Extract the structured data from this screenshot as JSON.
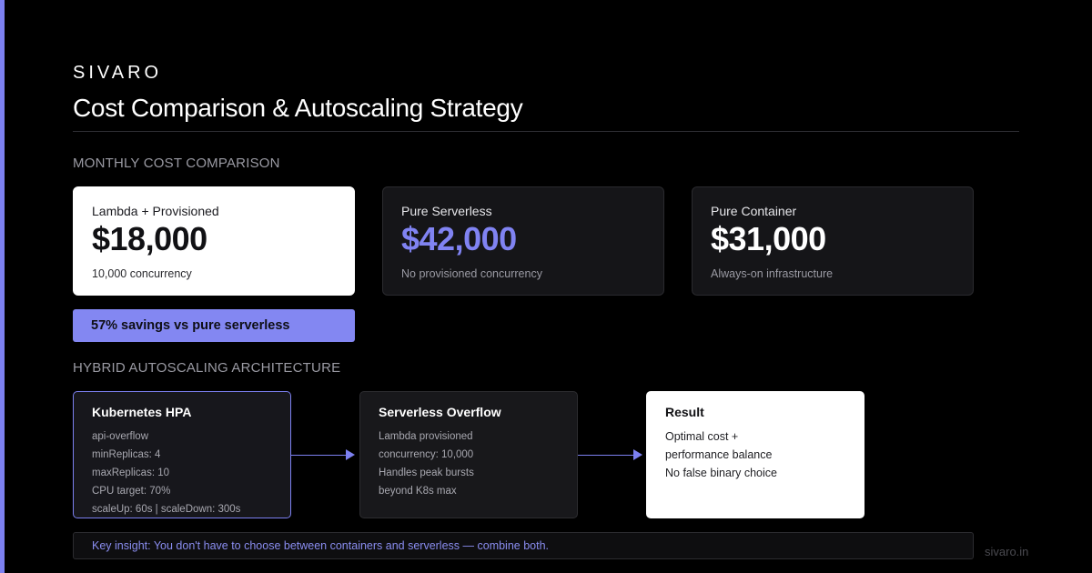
{
  "brand": "SIVARO",
  "title": "Cost Comparison & Autoscaling Strategy",
  "cost_section": {
    "label": "MONTHLY COST COMPARISON",
    "cards": [
      {
        "label": "Lambda + Provisioned",
        "value": "$18,000",
        "note": "10,000 concurrency"
      },
      {
        "label": "Pure Serverless",
        "value": "$42,000",
        "note": "No provisioned concurrency"
      },
      {
        "label": "Pure Container",
        "value": "$31,000",
        "note": "Always-on infrastructure"
      }
    ],
    "savings": "57% savings vs pure serverless"
  },
  "architecture_section": {
    "label": "HYBRID AUTOSCALING ARCHITECTURE",
    "boxes": [
      {
        "title": "Kubernetes HPA",
        "lines": [
          "api-overflow",
          "minReplicas: 4",
          "maxReplicas: 10",
          "CPU target: 70%",
          "scaleUp: 60s | scaleDown: 300s"
        ]
      },
      {
        "title": "Serverless Overflow",
        "lines": [
          "Lambda provisioned",
          "concurrency: 10,000",
          "Handles peak bursts",
          "beyond K8s max"
        ]
      },
      {
        "title": "Result",
        "lines": [
          "Optimal cost +",
          "performance balance",
          "No false binary choice"
        ]
      }
    ]
  },
  "insight": "Key insight: You don't have to choose between containers and serverless — combine both.",
  "footer_domain": "sivaro.in",
  "colors": {
    "accent": "#7c80f0",
    "background": "#000000",
    "card": "#151518"
  }
}
